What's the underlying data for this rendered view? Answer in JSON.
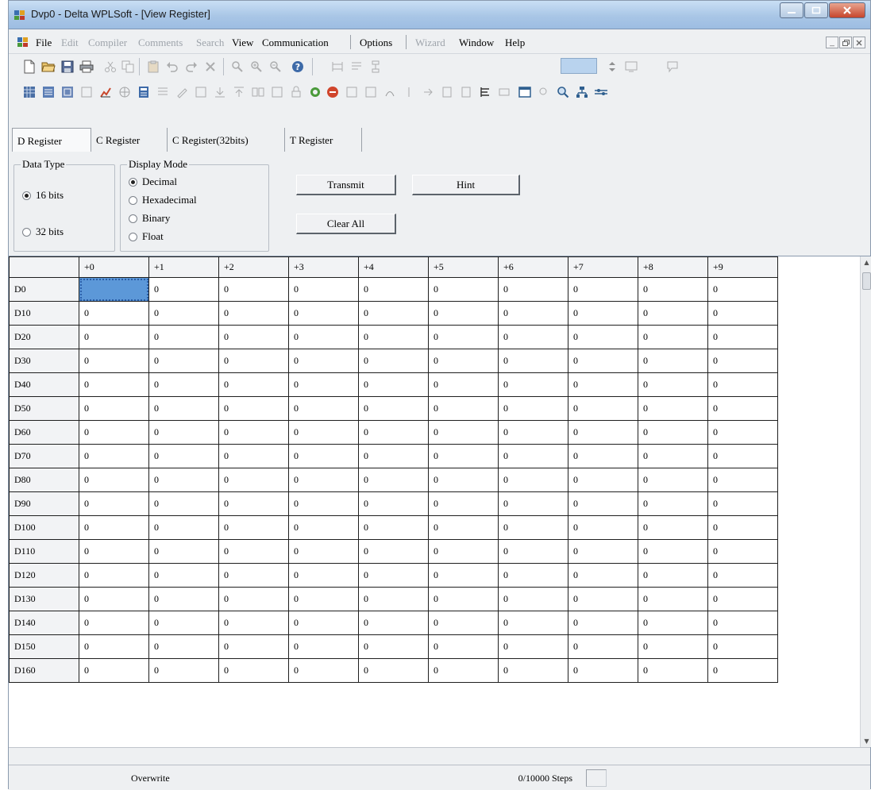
{
  "window": {
    "title": "Dvp0 - Delta WPLSoft - [View Register]"
  },
  "menu": {
    "items": [
      {
        "label": "File",
        "enabled": true
      },
      {
        "label": "Edit",
        "enabled": false
      },
      {
        "label": "Compiler",
        "enabled": false
      },
      {
        "label": "Comments",
        "enabled": false
      },
      {
        "label": "Search",
        "enabled": false
      },
      {
        "label": "View",
        "enabled": true
      },
      {
        "label": "Communication",
        "enabled": true
      },
      {
        "label": "Options",
        "enabled": true
      },
      {
        "label": "Wizard",
        "enabled": false
      },
      {
        "label": "Window",
        "enabled": true
      },
      {
        "label": "Help",
        "enabled": true
      }
    ]
  },
  "tabs": [
    {
      "label": "D Register",
      "active": true
    },
    {
      "label": "C Register",
      "active": false
    },
    {
      "label": "C Register(32bits)",
      "active": false
    },
    {
      "label": "T Register",
      "active": false
    }
  ],
  "data_type": {
    "legend": "Data Type",
    "options": [
      {
        "label": "16 bits",
        "checked": true
      },
      {
        "label": "32 bits",
        "checked": false
      }
    ]
  },
  "display_mode": {
    "legend": "Display Mode",
    "options": [
      {
        "label": "Decimal",
        "checked": true
      },
      {
        "label": "Hexadecimal",
        "checked": false
      },
      {
        "label": "Binary",
        "checked": false
      },
      {
        "label": "Float",
        "checked": false
      }
    ]
  },
  "buttons": {
    "transmit": "Transmit",
    "hint": "Hint",
    "clear_all": "Clear All"
  },
  "grid": {
    "columns": [
      "+0",
      "+1",
      "+2",
      "+3",
      "+4",
      "+5",
      "+6",
      "+7",
      "+8",
      "+9"
    ],
    "rows": [
      {
        "label": "D0",
        "values": [
          "0",
          "0",
          "0",
          "0",
          "0",
          "0",
          "0",
          "0",
          "0",
          "0"
        ]
      },
      {
        "label": "D10",
        "values": [
          "0",
          "0",
          "0",
          "0",
          "0",
          "0",
          "0",
          "0",
          "0",
          "0"
        ]
      },
      {
        "label": "D20",
        "values": [
          "0",
          "0",
          "0",
          "0",
          "0",
          "0",
          "0",
          "0",
          "0",
          "0"
        ]
      },
      {
        "label": "D30",
        "values": [
          "0",
          "0",
          "0",
          "0",
          "0",
          "0",
          "0",
          "0",
          "0",
          "0"
        ]
      },
      {
        "label": "D40",
        "values": [
          "0",
          "0",
          "0",
          "0",
          "0",
          "0",
          "0",
          "0",
          "0",
          "0"
        ]
      },
      {
        "label": "D50",
        "values": [
          "0",
          "0",
          "0",
          "0",
          "0",
          "0",
          "0",
          "0",
          "0",
          "0"
        ]
      },
      {
        "label": "D60",
        "values": [
          "0",
          "0",
          "0",
          "0",
          "0",
          "0",
          "0",
          "0",
          "0",
          "0"
        ]
      },
      {
        "label": "D70",
        "values": [
          "0",
          "0",
          "0",
          "0",
          "0",
          "0",
          "0",
          "0",
          "0",
          "0"
        ]
      },
      {
        "label": "D80",
        "values": [
          "0",
          "0",
          "0",
          "0",
          "0",
          "0",
          "0",
          "0",
          "0",
          "0"
        ]
      },
      {
        "label": "D90",
        "values": [
          "0",
          "0",
          "0",
          "0",
          "0",
          "0",
          "0",
          "0",
          "0",
          "0"
        ]
      },
      {
        "label": "D100",
        "values": [
          "0",
          "0",
          "0",
          "0",
          "0",
          "0",
          "0",
          "0",
          "0",
          "0"
        ]
      },
      {
        "label": "D110",
        "values": [
          "0",
          "0",
          "0",
          "0",
          "0",
          "0",
          "0",
          "0",
          "0",
          "0"
        ]
      },
      {
        "label": "D120",
        "values": [
          "0",
          "0",
          "0",
          "0",
          "0",
          "0",
          "0",
          "0",
          "0",
          "0"
        ]
      },
      {
        "label": "D130",
        "values": [
          "0",
          "0",
          "0",
          "0",
          "0",
          "0",
          "0",
          "0",
          "0",
          "0"
        ]
      },
      {
        "label": "D140",
        "values": [
          "0",
          "0",
          "0",
          "0",
          "0",
          "0",
          "0",
          "0",
          "0",
          "0"
        ]
      },
      {
        "label": "D150",
        "values": [
          "0",
          "0",
          "0",
          "0",
          "0",
          "0",
          "0",
          "0",
          "0",
          "0"
        ]
      },
      {
        "label": "D160",
        "values": [
          "0",
          "0",
          "0",
          "0",
          "0",
          "0",
          "0",
          "0",
          "0",
          "0"
        ]
      }
    ],
    "selected_cell": {
      "row": 0,
      "col": 0
    }
  },
  "status": {
    "mode": "Overwrite",
    "steps": "0/10000 Steps"
  },
  "colors": {
    "selection": "#5c98d8",
    "titlebar": "#a9c6e6",
    "close_button": "#c6452c"
  }
}
